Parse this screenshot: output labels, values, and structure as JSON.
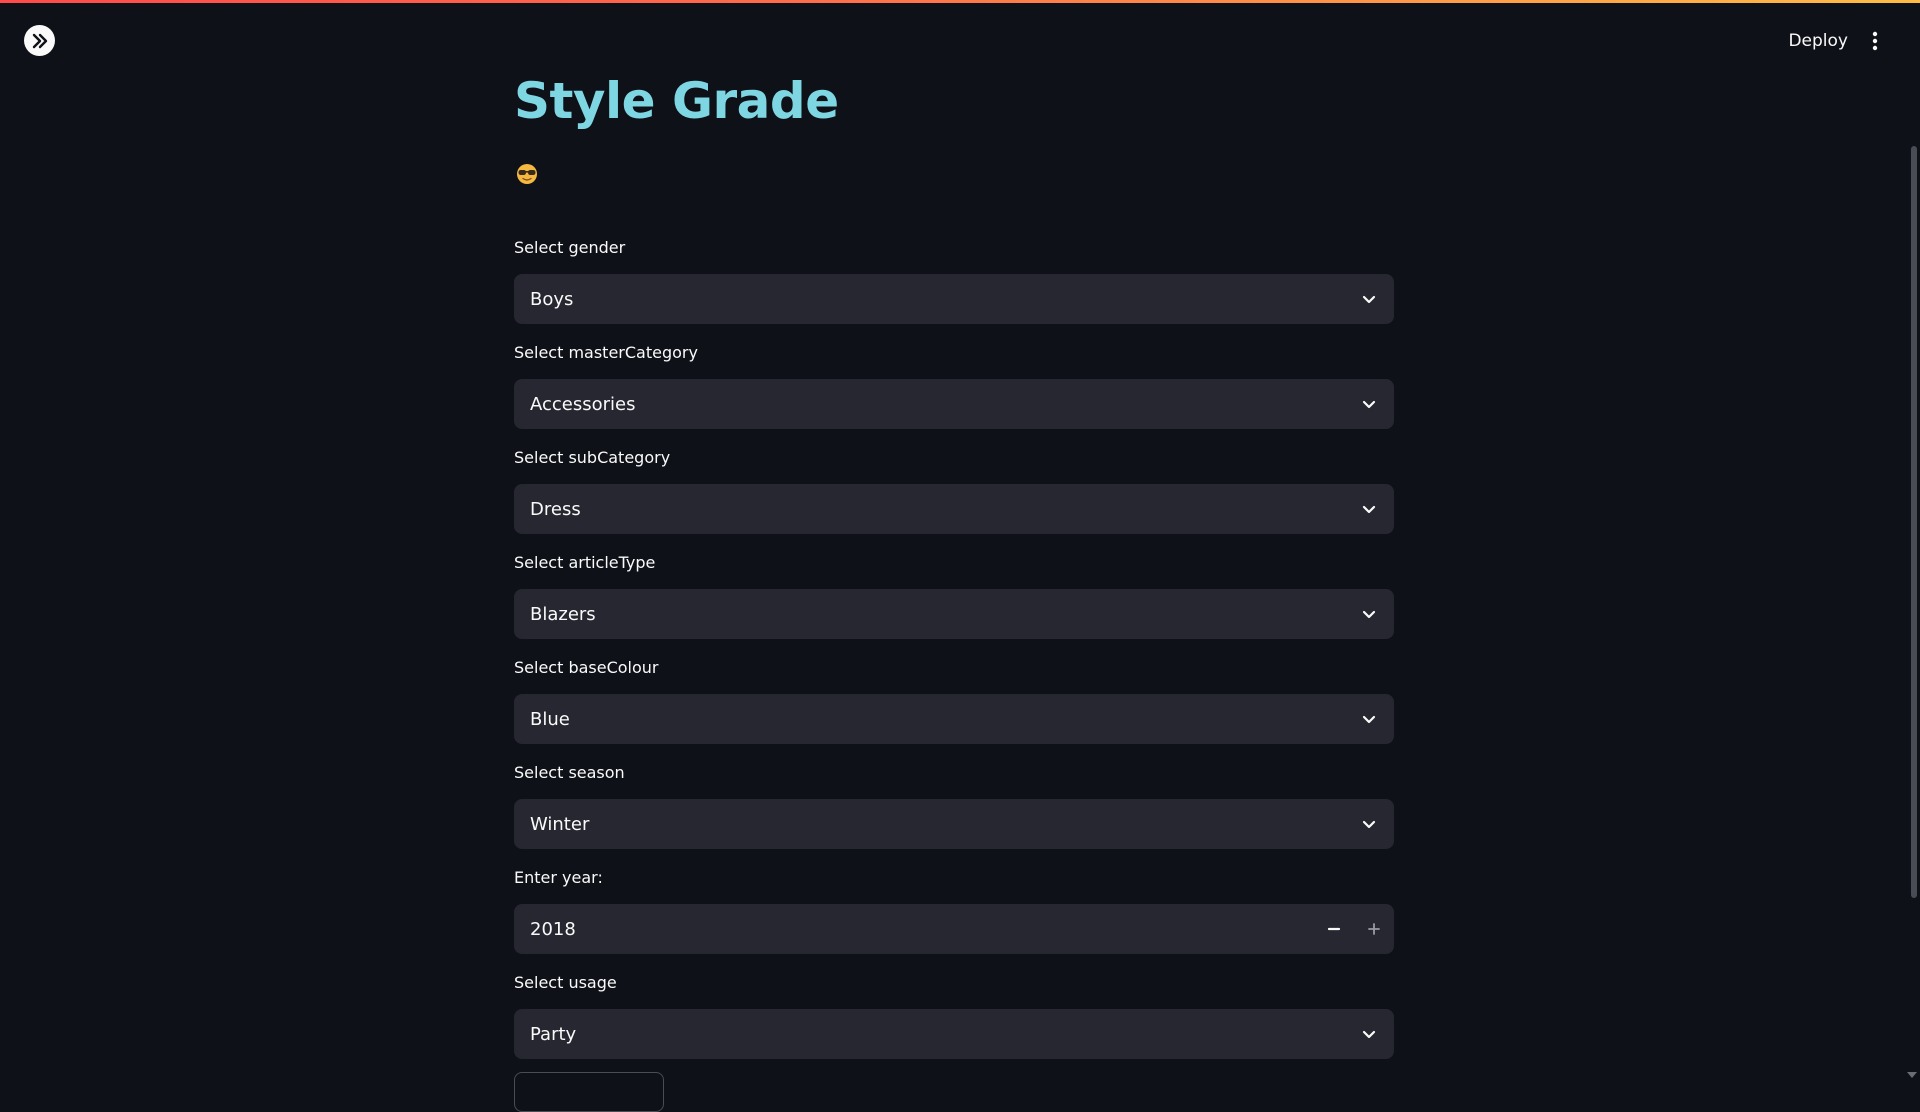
{
  "header": {
    "deploy_label": "Deploy"
  },
  "main": {
    "title": "Style Grade",
    "emoji": "😎",
    "fields": [
      {
        "label": "Select gender",
        "value": "Boys"
      },
      {
        "label": "Select masterCategory",
        "value": "Accessories"
      },
      {
        "label": "Select subCategory",
        "value": "Dress"
      },
      {
        "label": "Select articleType",
        "value": "Blazers"
      },
      {
        "label": "Select baseColour",
        "value": "Blue"
      },
      {
        "label": "Select season",
        "value": "Winter"
      },
      {
        "label": "Enter year:",
        "value": "2018"
      },
      {
        "label": "Select usage",
        "value": "Party"
      }
    ]
  },
  "colors": {
    "background": "#0e1117",
    "input_bg": "#262730",
    "title": "#7fd6e3",
    "accent_gradient_start": "#ff4b4b",
    "accent_gradient_end": "#ffbd45"
  },
  "icons": {
    "expand": "double-chevron-right-icon",
    "menu": "vertical-dots-icon",
    "dropdown": "chevron-down-icon",
    "decrement": "minus-icon",
    "increment": "plus-icon"
  }
}
